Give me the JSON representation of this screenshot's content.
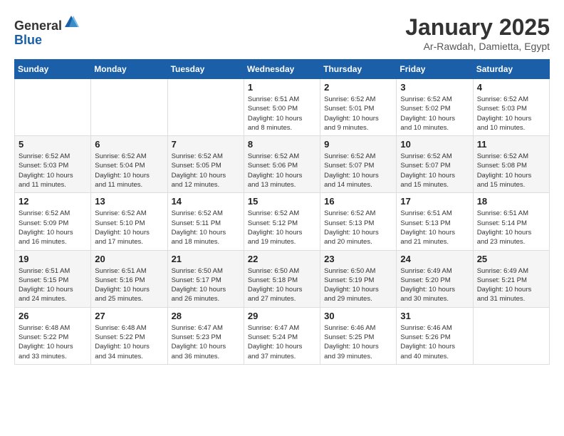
{
  "header": {
    "logo_line1": "General",
    "logo_line2": "Blue",
    "month": "January 2025",
    "location": "Ar-Rawdah, Damietta, Egypt"
  },
  "weekdays": [
    "Sunday",
    "Monday",
    "Tuesday",
    "Wednesday",
    "Thursday",
    "Friday",
    "Saturday"
  ],
  "weeks": [
    [
      {
        "day": "",
        "info": ""
      },
      {
        "day": "",
        "info": ""
      },
      {
        "day": "",
        "info": ""
      },
      {
        "day": "1",
        "info": "Sunrise: 6:51 AM\nSunset: 5:00 PM\nDaylight: 10 hours\nand 8 minutes."
      },
      {
        "day": "2",
        "info": "Sunrise: 6:52 AM\nSunset: 5:01 PM\nDaylight: 10 hours\nand 9 minutes."
      },
      {
        "day": "3",
        "info": "Sunrise: 6:52 AM\nSunset: 5:02 PM\nDaylight: 10 hours\nand 10 minutes."
      },
      {
        "day": "4",
        "info": "Sunrise: 6:52 AM\nSunset: 5:03 PM\nDaylight: 10 hours\nand 10 minutes."
      }
    ],
    [
      {
        "day": "5",
        "info": "Sunrise: 6:52 AM\nSunset: 5:03 PM\nDaylight: 10 hours\nand 11 minutes."
      },
      {
        "day": "6",
        "info": "Sunrise: 6:52 AM\nSunset: 5:04 PM\nDaylight: 10 hours\nand 11 minutes."
      },
      {
        "day": "7",
        "info": "Sunrise: 6:52 AM\nSunset: 5:05 PM\nDaylight: 10 hours\nand 12 minutes."
      },
      {
        "day": "8",
        "info": "Sunrise: 6:52 AM\nSunset: 5:06 PM\nDaylight: 10 hours\nand 13 minutes."
      },
      {
        "day": "9",
        "info": "Sunrise: 6:52 AM\nSunset: 5:07 PM\nDaylight: 10 hours\nand 14 minutes."
      },
      {
        "day": "10",
        "info": "Sunrise: 6:52 AM\nSunset: 5:07 PM\nDaylight: 10 hours\nand 15 minutes."
      },
      {
        "day": "11",
        "info": "Sunrise: 6:52 AM\nSunset: 5:08 PM\nDaylight: 10 hours\nand 15 minutes."
      }
    ],
    [
      {
        "day": "12",
        "info": "Sunrise: 6:52 AM\nSunset: 5:09 PM\nDaylight: 10 hours\nand 16 minutes."
      },
      {
        "day": "13",
        "info": "Sunrise: 6:52 AM\nSunset: 5:10 PM\nDaylight: 10 hours\nand 17 minutes."
      },
      {
        "day": "14",
        "info": "Sunrise: 6:52 AM\nSunset: 5:11 PM\nDaylight: 10 hours\nand 18 minutes."
      },
      {
        "day": "15",
        "info": "Sunrise: 6:52 AM\nSunset: 5:12 PM\nDaylight: 10 hours\nand 19 minutes."
      },
      {
        "day": "16",
        "info": "Sunrise: 6:52 AM\nSunset: 5:13 PM\nDaylight: 10 hours\nand 20 minutes."
      },
      {
        "day": "17",
        "info": "Sunrise: 6:51 AM\nSunset: 5:13 PM\nDaylight: 10 hours\nand 21 minutes."
      },
      {
        "day": "18",
        "info": "Sunrise: 6:51 AM\nSunset: 5:14 PM\nDaylight: 10 hours\nand 23 minutes."
      }
    ],
    [
      {
        "day": "19",
        "info": "Sunrise: 6:51 AM\nSunset: 5:15 PM\nDaylight: 10 hours\nand 24 minutes."
      },
      {
        "day": "20",
        "info": "Sunrise: 6:51 AM\nSunset: 5:16 PM\nDaylight: 10 hours\nand 25 minutes."
      },
      {
        "day": "21",
        "info": "Sunrise: 6:50 AM\nSunset: 5:17 PM\nDaylight: 10 hours\nand 26 minutes."
      },
      {
        "day": "22",
        "info": "Sunrise: 6:50 AM\nSunset: 5:18 PM\nDaylight: 10 hours\nand 27 minutes."
      },
      {
        "day": "23",
        "info": "Sunrise: 6:50 AM\nSunset: 5:19 PM\nDaylight: 10 hours\nand 29 minutes."
      },
      {
        "day": "24",
        "info": "Sunrise: 6:49 AM\nSunset: 5:20 PM\nDaylight: 10 hours\nand 30 minutes."
      },
      {
        "day": "25",
        "info": "Sunrise: 6:49 AM\nSunset: 5:21 PM\nDaylight: 10 hours\nand 31 minutes."
      }
    ],
    [
      {
        "day": "26",
        "info": "Sunrise: 6:48 AM\nSunset: 5:22 PM\nDaylight: 10 hours\nand 33 minutes."
      },
      {
        "day": "27",
        "info": "Sunrise: 6:48 AM\nSunset: 5:22 PM\nDaylight: 10 hours\nand 34 minutes."
      },
      {
        "day": "28",
        "info": "Sunrise: 6:47 AM\nSunset: 5:23 PM\nDaylight: 10 hours\nand 36 minutes."
      },
      {
        "day": "29",
        "info": "Sunrise: 6:47 AM\nSunset: 5:24 PM\nDaylight: 10 hours\nand 37 minutes."
      },
      {
        "day": "30",
        "info": "Sunrise: 6:46 AM\nSunset: 5:25 PM\nDaylight: 10 hours\nand 39 minutes."
      },
      {
        "day": "31",
        "info": "Sunrise: 6:46 AM\nSunset: 5:26 PM\nDaylight: 10 hours\nand 40 minutes."
      },
      {
        "day": "",
        "info": ""
      }
    ]
  ]
}
